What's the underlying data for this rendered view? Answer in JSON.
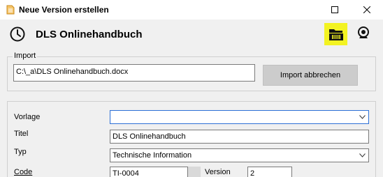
{
  "window": {
    "title": "Neue Version erstellen"
  },
  "header": {
    "title": "DLS Onlinehandbuch",
    "highlight_color": "#f3f322"
  },
  "import": {
    "legend": "Import",
    "path_value": "C:\\_a\\DLS Onlinehandbuch.docx",
    "cancel_label": "Import abbrechen"
  },
  "form": {
    "vorlage_label": "Vorlage",
    "vorlage_value": "",
    "titel_label": "Titel",
    "titel_value": "DLS Onlinehandbuch",
    "typ_label": "Typ",
    "typ_value": "Technische Information",
    "code_label": "Code",
    "code_value": "TI-0004",
    "version_label": "Version",
    "version_value": "2"
  },
  "icons": {
    "app": "document-icon",
    "maximize": "maximize-icon",
    "close": "close-icon",
    "clock": "clock-icon",
    "folder": "folder-icon",
    "webcam": "webcam-icon",
    "dropdown": "chevron-down-icon"
  }
}
